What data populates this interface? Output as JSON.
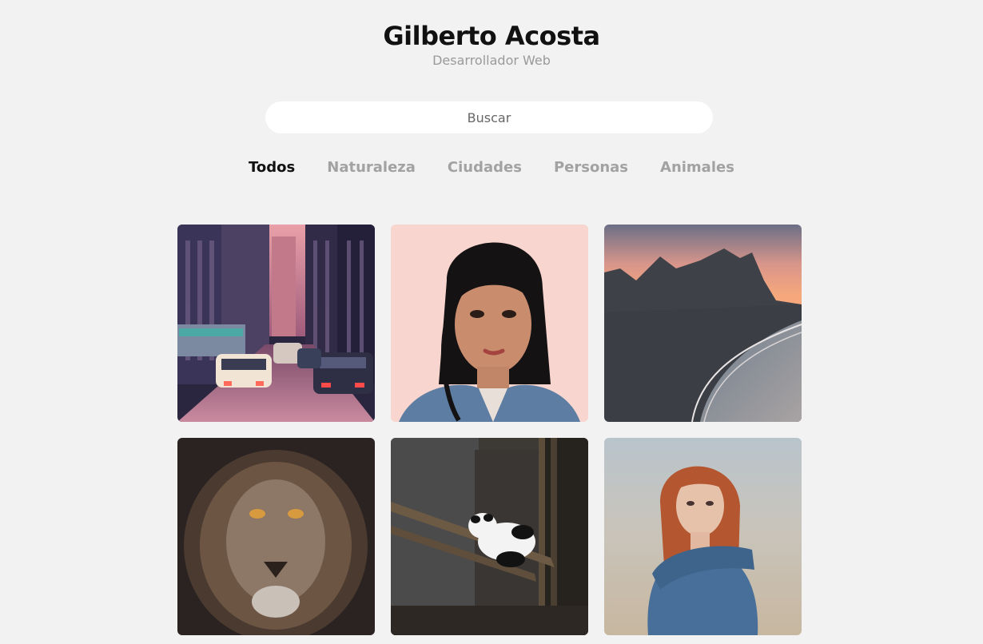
{
  "header": {
    "title": "Gilberto Acosta",
    "subtitle": "Desarrollador Web"
  },
  "search": {
    "placeholder": "Buscar",
    "value": ""
  },
  "categories": [
    {
      "label": "Todos",
      "active": true
    },
    {
      "label": "Naturaleza",
      "active": false
    },
    {
      "label": "Ciudades",
      "active": false
    },
    {
      "label": "Personas",
      "active": false
    },
    {
      "label": "Animales",
      "active": false
    }
  ],
  "gallery": [
    {
      "subject": "city-street"
    },
    {
      "subject": "woman-portrait-pink"
    },
    {
      "subject": "mountain-coast"
    },
    {
      "subject": "lion"
    },
    {
      "subject": "panda"
    },
    {
      "subject": "red-haired-woman"
    }
  ]
}
